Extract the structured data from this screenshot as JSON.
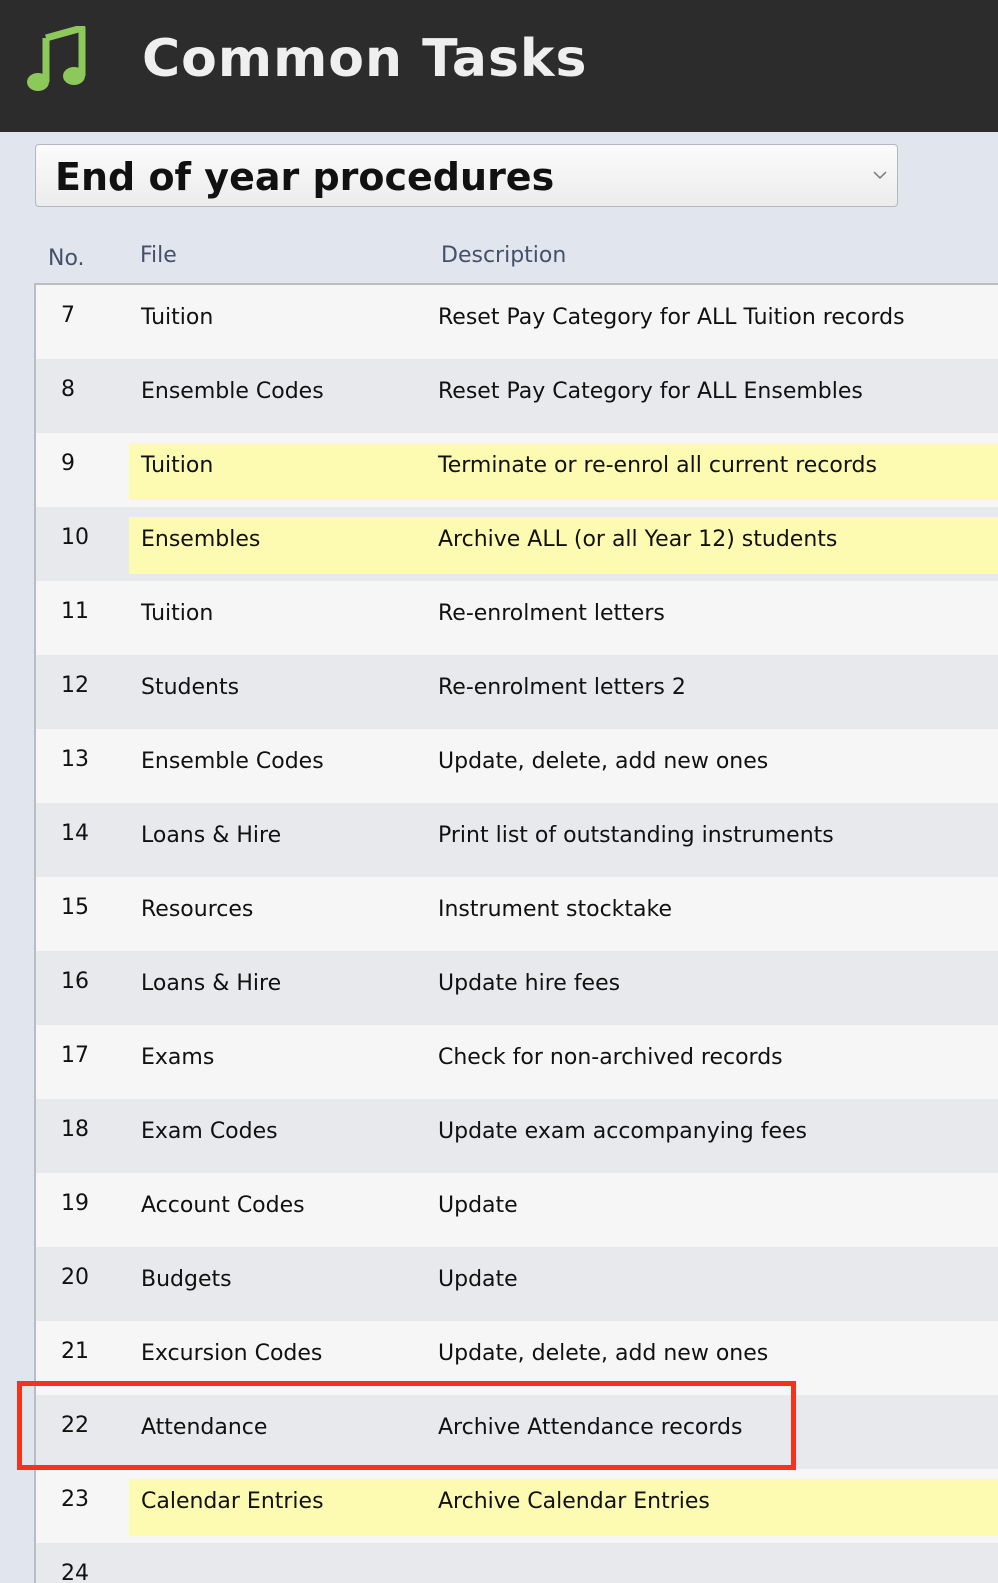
{
  "header": {
    "title": "Common Tasks",
    "icon": "music-note-icon",
    "icon_color": "#8dc85a"
  },
  "selector": {
    "value": "End of year procedures"
  },
  "columns": {
    "no": "No.",
    "file": "File",
    "description": "Description"
  },
  "rows": [
    {
      "no": "7",
      "file": "Tuition",
      "description": "Reset Pay Category for ALL Tuition records",
      "highlighted": false
    },
    {
      "no": "8",
      "file": "Ensemble Codes",
      "description": "Reset Pay Category for ALL Ensembles",
      "highlighted": false
    },
    {
      "no": "9",
      "file": "Tuition",
      "description": "Terminate or re-enrol all current records",
      "highlighted": true
    },
    {
      "no": "10",
      "file": "Ensembles",
      "description": "Archive ALL (or all Year 12) students",
      "highlighted": true
    },
    {
      "no": "11",
      "file": "Tuition",
      "description": "Re-enrolment letters",
      "highlighted": false
    },
    {
      "no": "12",
      "file": "Students",
      "description": "Re-enrolment letters 2",
      "highlighted": false
    },
    {
      "no": "13",
      "file": "Ensemble Codes",
      "description": "Update, delete, add new ones",
      "highlighted": false
    },
    {
      "no": "14",
      "file": "Loans & Hire",
      "description": "Print list of outstanding instruments",
      "highlighted": false
    },
    {
      "no": "15",
      "file": "Resources",
      "description": "Instrument stocktake",
      "highlighted": false
    },
    {
      "no": "16",
      "file": "Loans & Hire",
      "description": "Update hire fees",
      "highlighted": false
    },
    {
      "no": "17",
      "file": "Exams",
      "description": "Check for non-archived records",
      "highlighted": false
    },
    {
      "no": "18",
      "file": "Exam Codes",
      "description": "Update exam accompanying fees",
      "highlighted": false
    },
    {
      "no": "19",
      "file": "Account Codes",
      "description": "Update",
      "highlighted": false
    },
    {
      "no": "20",
      "file": "Budgets",
      "description": "Update",
      "highlighted": false
    },
    {
      "no": "21",
      "file": "Excursion Codes",
      "description": "Update, delete, add new ones",
      "highlighted": false
    },
    {
      "no": "22",
      "file": "Attendance",
      "description": "Archive Attendance records",
      "highlighted": false
    },
    {
      "no": "23",
      "file": "Calendar Entries",
      "description": "Archive Calendar Entries",
      "highlighted": true
    },
    {
      "no": "24",
      "file": "",
      "description": "",
      "highlighted": false
    }
  ],
  "colors": {
    "header_bg": "#2c2c2c",
    "row_even": "#f6f6f6",
    "row_odd": "#e7e9ec",
    "highlight": "#fdfbb2",
    "focus_outline": "#f5321c"
  }
}
